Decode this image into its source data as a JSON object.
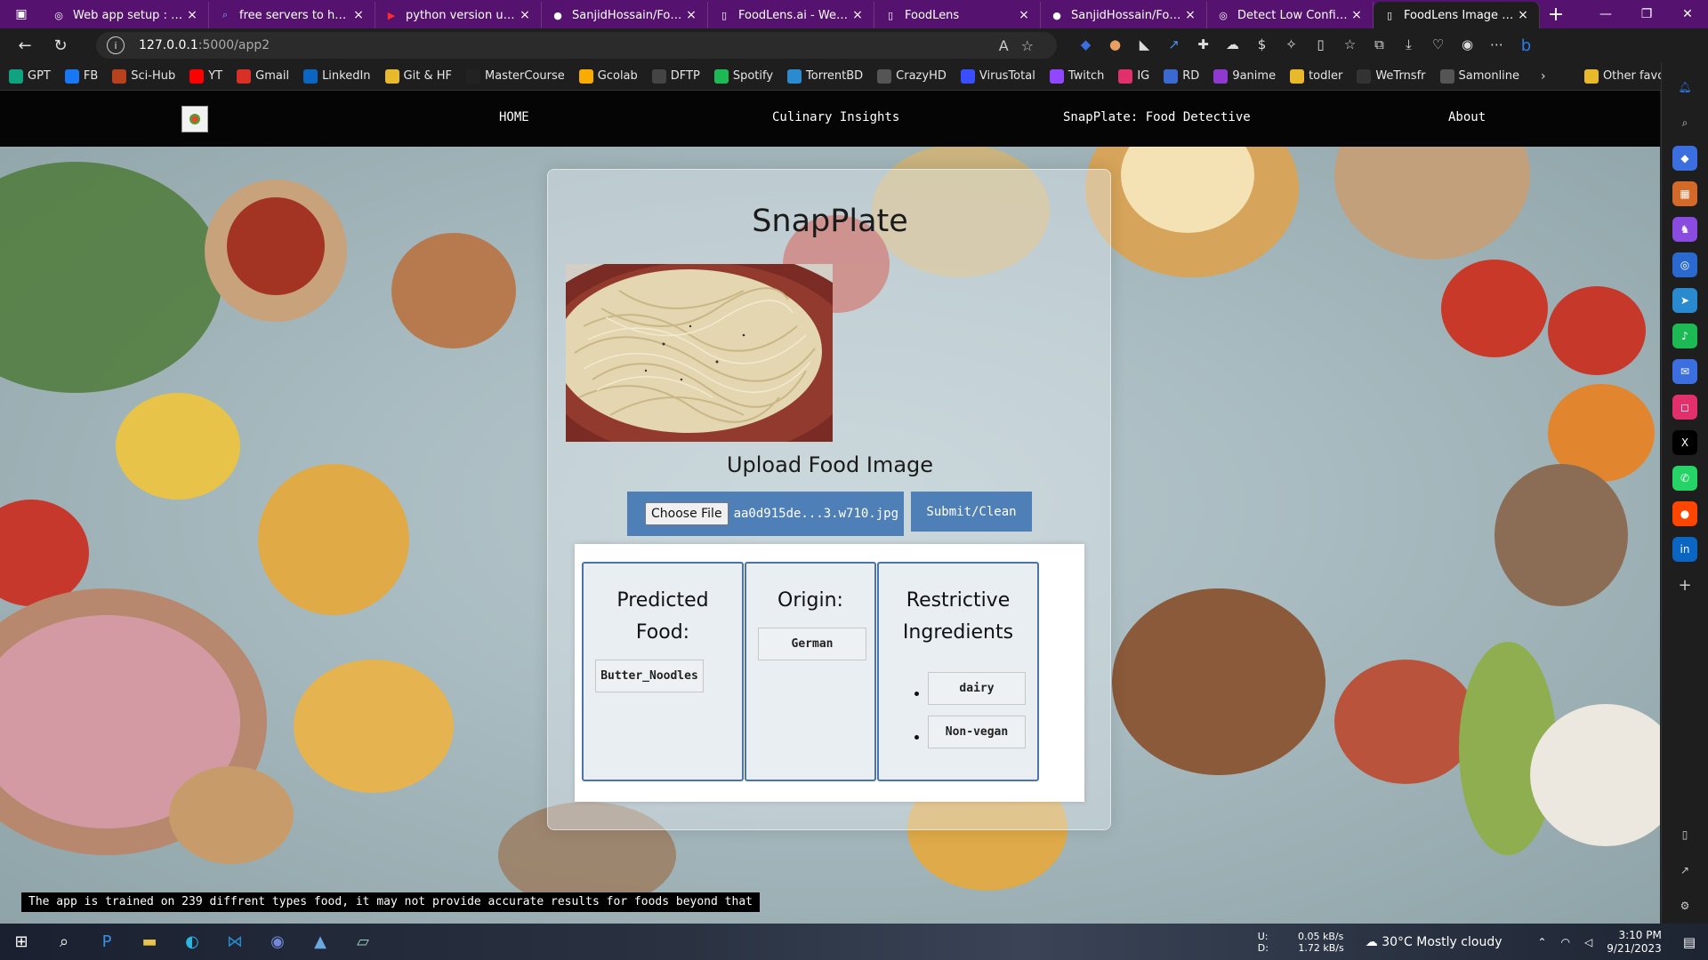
{
  "tabs": [
    {
      "title": "Web app setup : sanjid",
      "icon": "chatgpt-icon",
      "active": false
    },
    {
      "title": "free servers to host flask",
      "icon": "search-icon",
      "active": false
    },
    {
      "title": "python version update",
      "icon": "youtube-icon",
      "active": false
    },
    {
      "title": "SanjidHossain/FoodLens",
      "icon": "github-icon",
      "active": false
    },
    {
      "title": "FoodLens.ai - Web Server",
      "icon": "page-icon",
      "active": false
    },
    {
      "title": "FoodLens",
      "icon": "page-icon",
      "active": false
    },
    {
      "title": "SanjidHossain/FoodLens",
      "icon": "github-icon",
      "active": false
    },
    {
      "title": "Detect Low Confidence",
      "icon": "chatgpt-icon",
      "active": false
    },
    {
      "title": "FoodLens Image App",
      "icon": "page-icon",
      "active": true
    }
  ],
  "address": {
    "host": "127.0.0.1",
    "path": ":5000/app2"
  },
  "bookmarks": [
    {
      "label": "GPT",
      "color": "#10a37f"
    },
    {
      "label": "FB",
      "color": "#1877f2"
    },
    {
      "label": "Sci-Hub",
      "color": "#b7411d"
    },
    {
      "label": "YT",
      "color": "#ff0000"
    },
    {
      "label": "Gmail",
      "color": "#d93025"
    },
    {
      "label": "LinkedIn",
      "color": "#0a66c2"
    },
    {
      "label": "Git & HF",
      "color": "#e7b92b"
    },
    {
      "label": "MasterCourse",
      "color": "#222222"
    },
    {
      "label": "Gcolab",
      "color": "#f9ab00"
    },
    {
      "label": "DFTP",
      "color": "#444444"
    },
    {
      "label": "Spotify",
      "color": "#1db954"
    },
    {
      "label": "TorrentBD",
      "color": "#2a8bd0"
    },
    {
      "label": "CrazyHD",
      "color": "#555555"
    },
    {
      "label": "VirusTotal",
      "color": "#394eff"
    },
    {
      "label": "Twitch",
      "color": "#9146ff"
    },
    {
      "label": "IG",
      "color": "#e1306c"
    },
    {
      "label": "RD",
      "color": "#3a6ad0"
    },
    {
      "label": "9anime",
      "color": "#8e3ad0"
    },
    {
      "label": "todler",
      "color": "#e7b92b"
    },
    {
      "label": "WeTrnsfr",
      "color": "#333333"
    },
    {
      "label": "Samonline",
      "color": "#555555"
    }
  ],
  "other_favorites": "Other favorites",
  "site": {
    "nav": {
      "home": "HOME",
      "insights": "Culinary Insights",
      "detective": "SnapPlate: Food Detective",
      "about": "About"
    },
    "title": "SnapPlate",
    "upload_label": "Upload Food Image",
    "choose_file": "Choose File",
    "file_name": "aa0d915de...3.w710.jpg",
    "submit_label": "Submit/Clean",
    "results": {
      "predicted_heading_1": "Predicted",
      "predicted_heading_2": "Food:",
      "predicted_value": "Butter_Noodles",
      "origin_heading": "Origin:",
      "origin_value": "German",
      "restrict_heading_1": "Restrictive",
      "restrict_heading_2": "Ingredients",
      "restrictions": [
        "dairy",
        "Non-vegan"
      ]
    },
    "disclaimer": "The app is trained on 239 diffrent types food, it may not provide accurate results for foods beyond that"
  },
  "taskbar": {
    "net_up": "U:",
    "net_down": "D:",
    "net_up_speed": "0.05 kB/s",
    "net_down_speed": "1.72 kB/s",
    "weather": "30°C  Mostly cloudy",
    "time": "3:10 PM",
    "date": "9/21/2023"
  },
  "colors": {
    "tabstrip": "#55126e",
    "accent_blue": "#4f7fb7",
    "column_border": "#4a74ab"
  }
}
